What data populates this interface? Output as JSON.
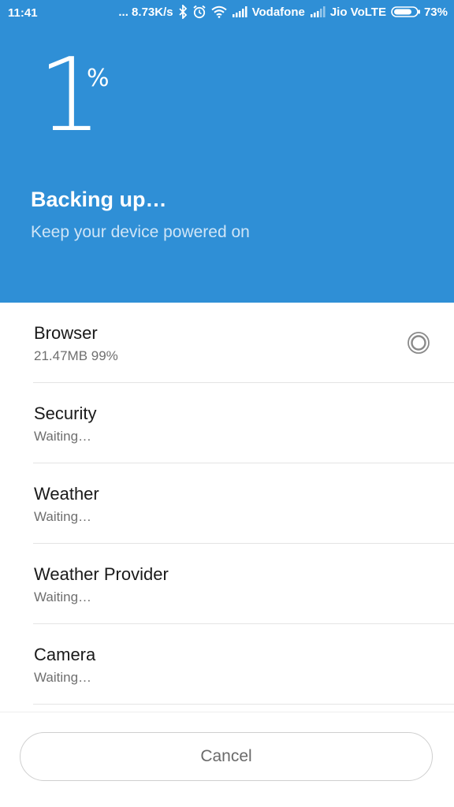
{
  "status_bar": {
    "time": "11:41",
    "network_speed": "... 8.73K/s",
    "carrier1": "Vodafone",
    "carrier2": "Jio VoLTE",
    "battery": "73%",
    "icons": [
      "bluetooth-icon",
      "alarm-icon",
      "wifi-icon",
      "signal-icon",
      "signal-icon",
      "battery-icon"
    ]
  },
  "header": {
    "percent_value": "1",
    "percent_sign": "%",
    "title": "Backing up…",
    "subtitle": "Keep your device powered on",
    "background_color": "#2f8fd6"
  },
  "list": {
    "items": [
      {
        "name": "Browser",
        "status": "21.47MB 99%"
      },
      {
        "name": "Security",
        "status": "Waiting…"
      },
      {
        "name": "Weather",
        "status": "Waiting…"
      },
      {
        "name": "Weather Provider",
        "status": "Waiting…"
      },
      {
        "name": "Camera",
        "status": "Waiting…"
      }
    ]
  },
  "footer": {
    "cancel_label": "Cancel"
  }
}
